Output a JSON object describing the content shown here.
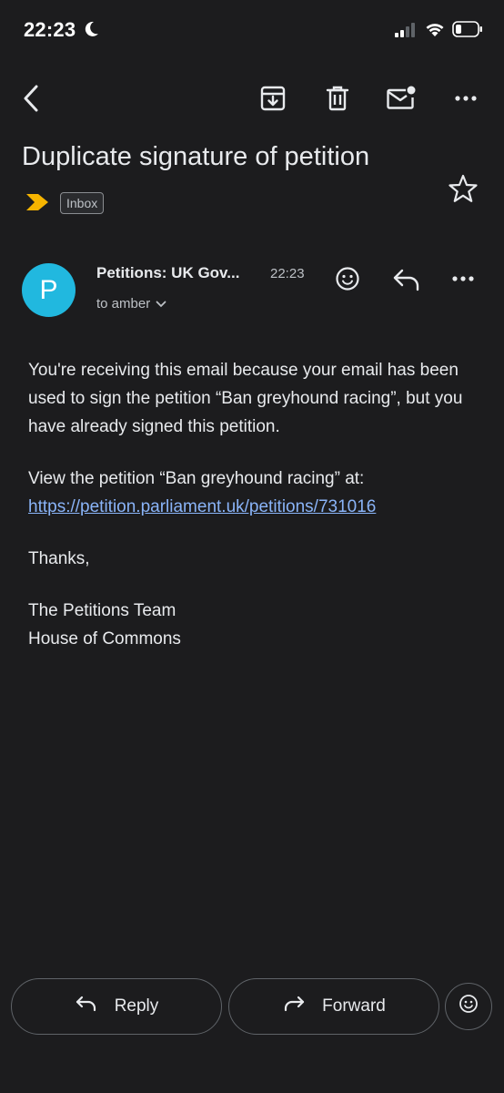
{
  "status_bar": {
    "time": "22:23"
  },
  "toolbar": {
    "icons": [
      "back-arrow-icon",
      "archive-icon",
      "trash-icon",
      "mark-unread-icon",
      "more-vertical-icon"
    ]
  },
  "subject": "Duplicate signature of petition",
  "labels": {
    "inbox": "Inbox"
  },
  "sender": {
    "avatar_letter": "P",
    "avatar_color": "#21b8df",
    "name": "Petitions: UK Gov...",
    "time": "22:23",
    "to": "to amber"
  },
  "body": {
    "para1": "You're receiving this email because your email has been used to sign the petition “Ban greyhound racing”, but you have already signed this petition.",
    "para2_text": "View the petition “Ban greyhound racing” at:",
    "link": "https://petition.parliament.uk/petitions/731016",
    "thanks": "Thanks,",
    "sign_line1": "The Petitions Team",
    "sign_line2": "House of Commons"
  },
  "actions": {
    "reply_label": "Reply",
    "forward_label": "Forward"
  },
  "colors": {
    "background": "#1c1c1e",
    "link": "#8ab4f8",
    "important_marker": "#f6b400"
  }
}
